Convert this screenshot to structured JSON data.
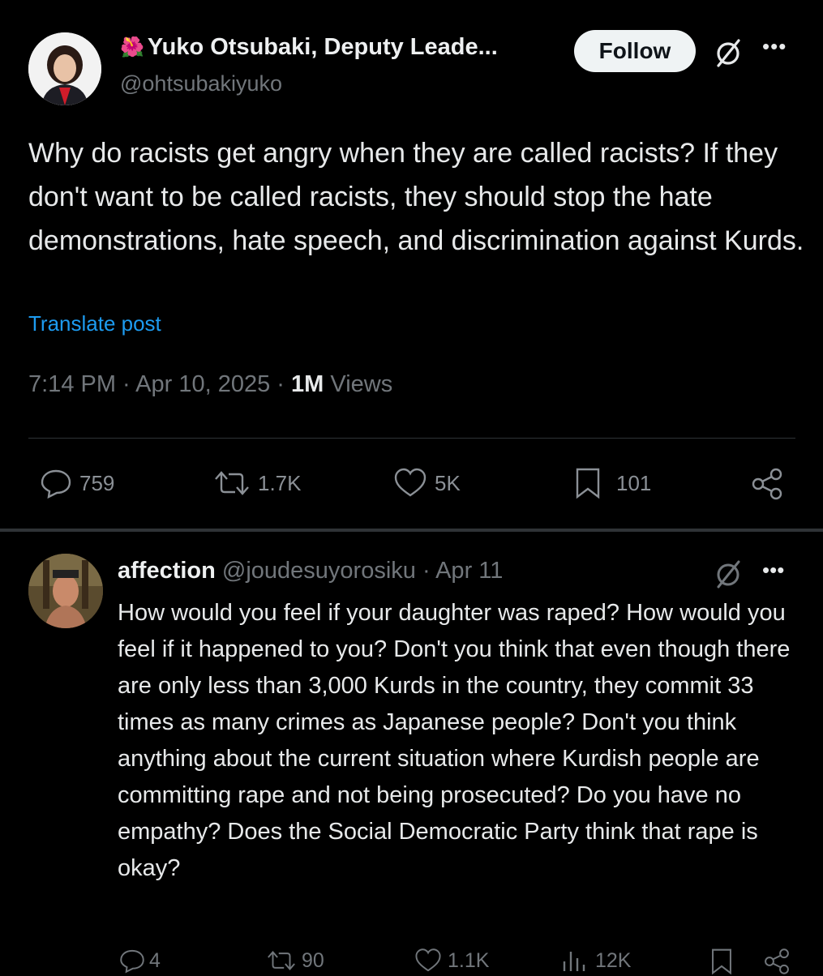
{
  "post": {
    "display_name": "Yuko Otsubaki, Deputy Leade...",
    "handle": "@ohtsubakiyuko",
    "follow_label": "Follow",
    "text": "Why do racists get angry when they are called racists? If they don't want to be called racists, they should stop the hate demonstrations, hate speech, and discrimination against Kurds.",
    "translate_label": "Translate post",
    "time": "7:14 PM · Apr 10, 2025 · ",
    "views_count": "1M",
    "views_label": " Views",
    "replies": "759",
    "reposts": "1.7K",
    "likes": "5K",
    "bookmarks": "101"
  },
  "reply": {
    "display_name": "affection",
    "handle": "@joudesuyorosiku",
    "date": " · Apr 11",
    "text": "How would you feel if your daughter was raped? How would you feel if it happened to you? Don't you think that even though there are only less than 3,000 Kurds in the country, they commit 33 times as many crimes as Japanese people? Don't you think anything about the current situation where Kurdish people are committing rape and not being prosecuted? Do you have no empathy? Does the Social Democratic Party think that rape is okay?",
    "replies": "4",
    "reposts": "90",
    "likes": "1.1K",
    "views": "12K"
  },
  "icons": {
    "grok": "grok-icon",
    "more": "more-icon",
    "reply": "reply-icon",
    "repost": "repost-icon",
    "like": "heart-icon",
    "bookmark": "bookmark-icon",
    "share": "share-icon",
    "views": "views-icon"
  },
  "colors": {
    "background": "#000000",
    "text": "#e7e9ea",
    "muted": "#71767b",
    "link": "#1d9bf0",
    "follow_bg": "#eff3f4"
  }
}
